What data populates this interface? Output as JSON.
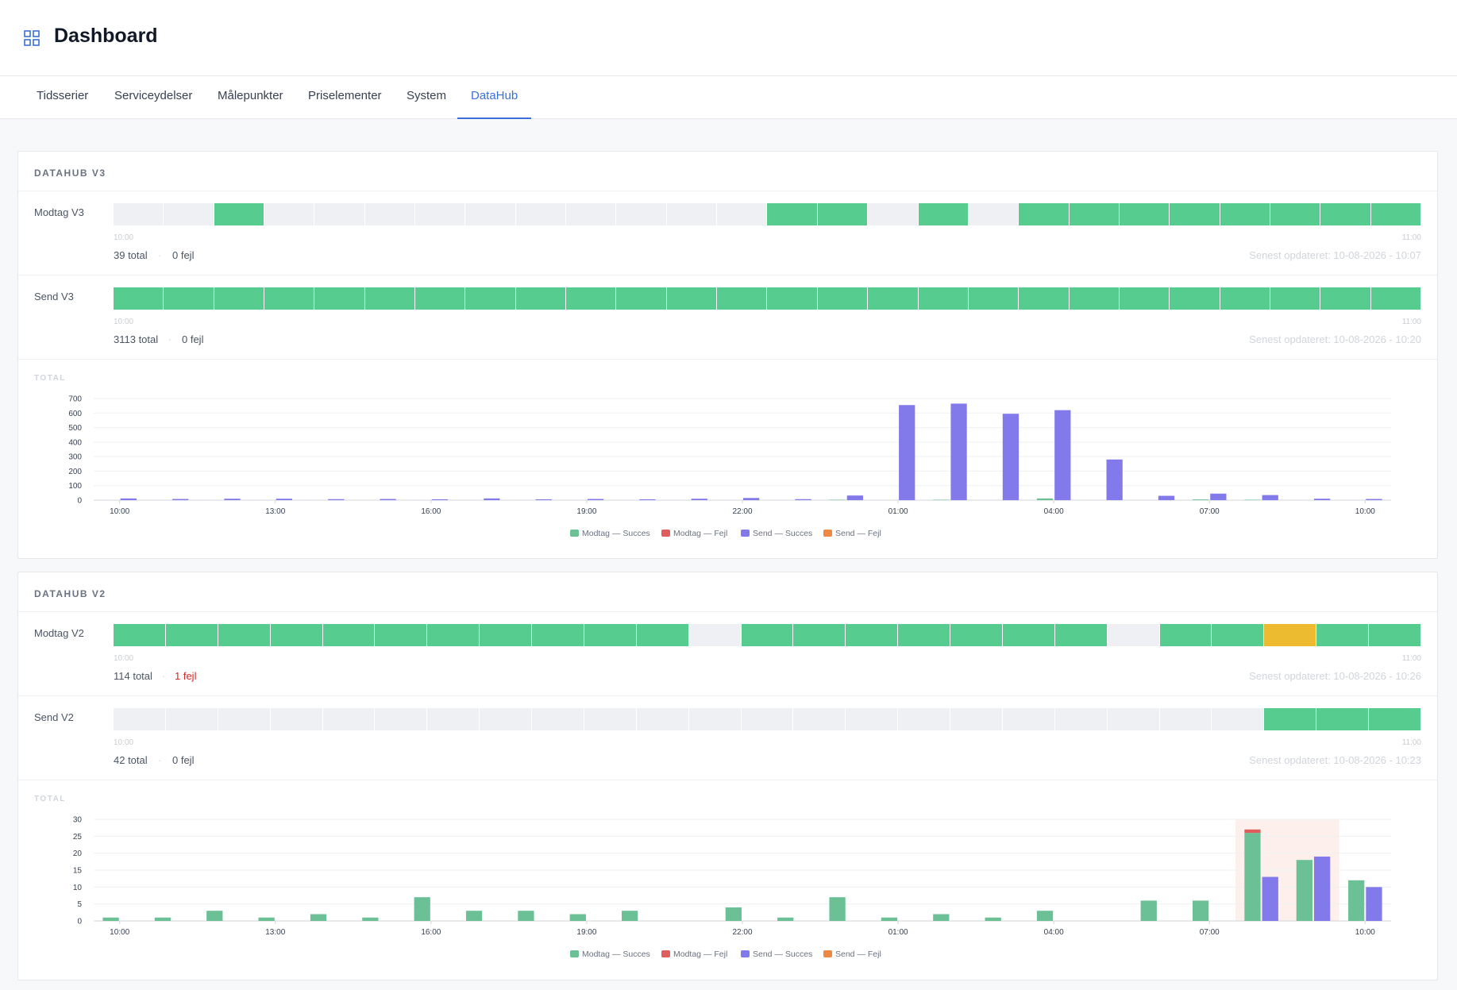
{
  "header": {
    "title": "Dashboard",
    "icon": "grid-icon"
  },
  "tabs": [
    {
      "label": "Tidsserier"
    },
    {
      "label": "Serviceydelser"
    },
    {
      "label": "Målepunkter"
    },
    {
      "label": "Priselementer"
    },
    {
      "label": "System"
    },
    {
      "label": "DataHub",
      "active": true
    }
  ],
  "colors": {
    "success": "#56cc8e",
    "empty": "#eef0f4",
    "warning": "#edbb2f",
    "modtag_succes": "#6cc095",
    "modtag_fejl": "#e05d5d",
    "send_succes": "#8279ea",
    "send_fejl": "#ee8945",
    "accent": "#3b6fd8"
  },
  "panels": [
    {
      "title": "DATAHUB V3",
      "rows": [
        {
          "label": "Modtag V3",
          "segments": [
            "empty",
            "empty",
            "success",
            "empty",
            "empty",
            "empty",
            "empty",
            "empty",
            "empty",
            "empty",
            "empty",
            "empty",
            "empty",
            "success",
            "success",
            "empty",
            "success",
            "empty",
            "success",
            "success",
            "success",
            "success",
            "success",
            "success",
            "success",
            "success"
          ],
          "start": "10:00",
          "end": "11:00",
          "total": "39 total",
          "errors": "0 fejl",
          "has_error": false,
          "updated": "Senest opdateret: 10-08-2026 - 10:07"
        },
        {
          "label": "Send V3",
          "segments": [
            "success",
            "success",
            "success",
            "success",
            "success",
            "success",
            "success",
            "success",
            "success",
            "success",
            "success",
            "success",
            "success",
            "success",
            "success",
            "success",
            "success",
            "success",
            "success",
            "success",
            "success",
            "success",
            "success",
            "success",
            "success",
            "success"
          ],
          "start": "10:00",
          "end": "11:00",
          "total": "3113 total",
          "errors": "0 fejl",
          "has_error": false,
          "updated": "Senest opdateret: 10-08-2026 - 10:20"
        }
      ],
      "chart_label": "TOTAL"
    },
    {
      "title": "DATAHUB V2",
      "rows": [
        {
          "label": "Modtag V2",
          "segments": [
            "success",
            "success",
            "success",
            "success",
            "success",
            "success",
            "success",
            "success",
            "success",
            "success",
            "success",
            "empty",
            "success",
            "success",
            "success",
            "success",
            "success",
            "success",
            "success",
            "empty",
            "success",
            "success",
            "warn",
            "success",
            "success"
          ],
          "start": "10:00",
          "end": "11:00",
          "total": "114 total",
          "errors": "1 fejl",
          "has_error": true,
          "updated": "Senest opdateret: 10-08-2026 - 10:26"
        },
        {
          "label": "Send V2",
          "segments": [
            "empty",
            "empty",
            "empty",
            "empty",
            "empty",
            "empty",
            "empty",
            "empty",
            "empty",
            "empty",
            "empty",
            "empty",
            "empty",
            "empty",
            "empty",
            "empty",
            "empty",
            "empty",
            "empty",
            "empty",
            "empty",
            "empty",
            "success",
            "success",
            "success"
          ],
          "start": "10:00",
          "end": "11:00",
          "total": "42 total",
          "errors": "0 fejl",
          "has_error": false,
          "updated": "Senest opdateret: 10-08-2026 - 10:23"
        }
      ],
      "chart_label": "TOTAL"
    }
  ],
  "chart_data": [
    {
      "type": "bar",
      "x": [
        "10:00",
        "11:00",
        "12:00",
        "13:00",
        "14:00",
        "15:00",
        "16:00",
        "17:00",
        "18:00",
        "19:00",
        "20:00",
        "21:00",
        "22:00",
        "23:00",
        "00:00",
        "01:00",
        "02:00",
        "03:00",
        "04:00",
        "05:00",
        "06:00",
        "07:00",
        "08:00",
        "09:00",
        "10:00"
      ],
      "xticks": [
        "10:00",
        "13:00",
        "16:00",
        "19:00",
        "22:00",
        "01:00",
        "04:00",
        "07:00",
        "10:00"
      ],
      "yticks": [
        0,
        100,
        200,
        300,
        400,
        500,
        600,
        700
      ],
      "ylim": [
        0,
        700
      ],
      "series": [
        {
          "name": "Modtag — Succes",
          "color": "#6cc095",
          "values": [
            0,
            0,
            0,
            0,
            0,
            0,
            0,
            0,
            0,
            0,
            0,
            0,
            0,
            0,
            3,
            0,
            3,
            0,
            12,
            0,
            0,
            5,
            3,
            0,
            0
          ]
        },
        {
          "name": "Modtag — Fejl",
          "color": "#e05d5d",
          "values": [
            0,
            0,
            0,
            0,
            0,
            0,
            0,
            0,
            0,
            0,
            0,
            0,
            0,
            0,
            0,
            0,
            0,
            0,
            0,
            0,
            0,
            0,
            0,
            0,
            0
          ]
        },
        {
          "name": "Send — Succes",
          "color": "#8279ea",
          "values": [
            12,
            8,
            10,
            10,
            7,
            8,
            6,
            12,
            6,
            8,
            6,
            10,
            15,
            7,
            32,
            655,
            665,
            595,
            620,
            280,
            30,
            45,
            35,
            10,
            8
          ]
        },
        {
          "name": "Send — Fejl",
          "color": "#ee8945",
          "values": [
            0,
            0,
            0,
            0,
            0,
            0,
            0,
            0,
            0,
            0,
            0,
            0,
            0,
            0,
            0,
            0,
            0,
            0,
            0,
            0,
            0,
            0,
            0,
            0,
            0
          ]
        }
      ],
      "legend": "bottom"
    },
    {
      "type": "bar",
      "x": [
        "10:00",
        "11:00",
        "12:00",
        "13:00",
        "14:00",
        "15:00",
        "16:00",
        "17:00",
        "18:00",
        "19:00",
        "20:00",
        "21:00",
        "22:00",
        "23:00",
        "00:00",
        "01:00",
        "02:00",
        "03:00",
        "04:00",
        "05:00",
        "06:00",
        "07:00",
        "08:00",
        "09:00",
        "10:00"
      ],
      "xticks": [
        "10:00",
        "13:00",
        "16:00",
        "19:00",
        "22:00",
        "01:00",
        "04:00",
        "07:00",
        "10:00"
      ],
      "yticks": [
        0,
        5,
        10,
        15,
        20,
        25,
        30
      ],
      "ylim": [
        0,
        30
      ],
      "highlight_range": [
        22,
        23
      ],
      "series": [
        {
          "name": "Modtag — Succes",
          "color": "#6cc095",
          "values": [
            1,
            1,
            3,
            1,
            2,
            1,
            7,
            3,
            3,
            2,
            3,
            0,
            4,
            1,
            7,
            1,
            2,
            1,
            3,
            0,
            6,
            6,
            26,
            18,
            12
          ]
        },
        {
          "name": "Modtag — Fejl",
          "color": "#e05d5d",
          "values": [
            0,
            0,
            0,
            0,
            0,
            0,
            0,
            0,
            0,
            0,
            0,
            0,
            0,
            0,
            0,
            0,
            0,
            0,
            0,
            0,
            0,
            0,
            1,
            0,
            0
          ]
        },
        {
          "name": "Send — Succes",
          "color": "#8279ea",
          "values": [
            0,
            0,
            0,
            0,
            0,
            0,
            0,
            0,
            0,
            0,
            0,
            0,
            0,
            0,
            0,
            0,
            0,
            0,
            0,
            0,
            0,
            0,
            13,
            19,
            10
          ]
        },
        {
          "name": "Send — Fejl",
          "color": "#ee8945",
          "values": [
            0,
            0,
            0,
            0,
            0,
            0,
            0,
            0,
            0,
            0,
            0,
            0,
            0,
            0,
            0,
            0,
            0,
            0,
            0,
            0,
            0,
            0,
            0,
            0,
            0
          ]
        }
      ],
      "legend": "bottom"
    }
  ]
}
